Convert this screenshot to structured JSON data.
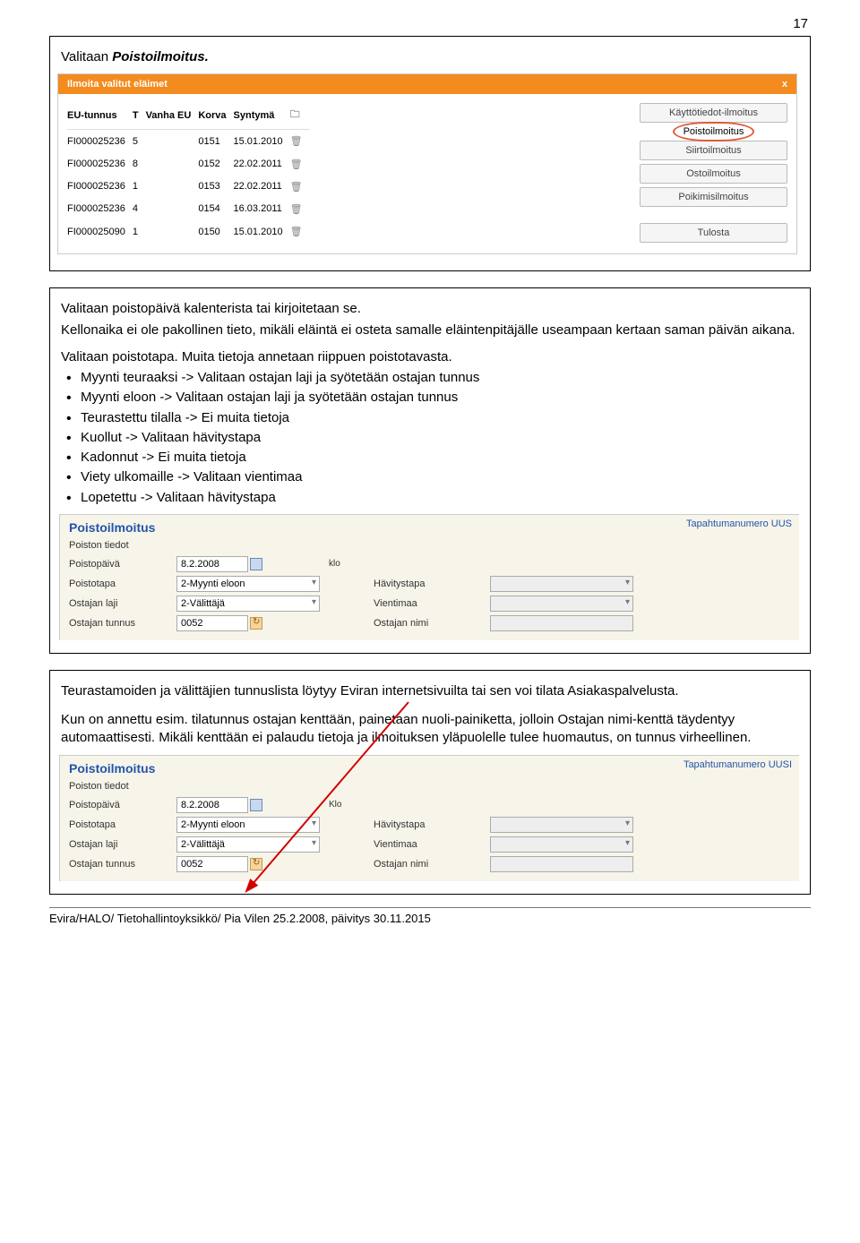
{
  "pageNumber": "17",
  "box1": {
    "intro1": "Valitaan ",
    "intro2": "Poistoilmoitus."
  },
  "shot1": {
    "header": "Ilmoita valitut eläimet",
    "cols": [
      "EU-tunnus",
      "T",
      "Vanha EU",
      "Korva",
      "Syntymä"
    ],
    "rows": [
      {
        "eu": "FI000025236",
        "t": "5",
        "v": "",
        "korva": "0151",
        "s": "15.01.2010"
      },
      {
        "eu": "FI000025236",
        "t": "8",
        "v": "",
        "korva": "0152",
        "s": "22.02.2011"
      },
      {
        "eu": "FI000025236",
        "t": "1",
        "v": "",
        "korva": "0153",
        "s": "22.02.2011"
      },
      {
        "eu": "FI000025236",
        "t": "4",
        "v": "",
        "korva": "0154",
        "s": "16.03.2011"
      },
      {
        "eu": "FI000025090",
        "t": "1",
        "v": "",
        "korva": "0150",
        "s": "15.01.2010"
      }
    ],
    "buttons": {
      "kt": "Käyttötiedot-ilmoitus",
      "poisto": "Poistoilmoitus",
      "siirto": "Siirtoilmoitus",
      "osto": "Ostoilmoitus",
      "poikimi": "Poikimisilmoitus",
      "tulosta": "Tulosta"
    },
    "close": "x"
  },
  "box2": {
    "l1": "Valitaan poistopäivä kalenterista tai kirjoitetaan se.",
    "l2": "Kellonaika ei ole pakollinen tieto, mikäli eläintä ei osteta samalle eläintenpitäjälle useampaan kertaan saman päivän aikana.",
    "l3": "Valitaan poistotapa. Muita tietoja annetaan riippuen poistotavasta.",
    "bullets": [
      "Myynti teuraaksi -> Valitaan ostajan laji ja syötetään ostajan tunnus",
      "Myynti eloon -> Valitaan ostajan laji ja syötetään ostajan tunnus",
      "Teurastettu tilalla -> Ei muita tietoja",
      "Kuollut -> Valitaan hävitystapa",
      "Kadonnut -> Ei muita tietoja",
      "Viety ulkomaille -> Valitaan vientimaa",
      "Lopetettu -> Valitaan hävitystapa"
    ]
  },
  "form": {
    "tapnum_short": "Tapahtumanumero UUS",
    "tapnum_long": "Tapahtumanumero UUSI",
    "title": "Poistoilmoitus",
    "section": "Poiston tiedot",
    "labels": {
      "pvm": "Poistopäivä",
      "ptapa": "Poistotapa",
      "laji": "Ostajan laji",
      "tunnus": "Ostajan tunnus",
      "havitys": "Hävitystapa",
      "vientimaa": "Vientimaa",
      "nimi": "Ostajan nimi",
      "klo": "klo",
      "KloCap": "Klo"
    },
    "values": {
      "pvm": "8.2.2008",
      "ptapa": "2-Myynti eloon",
      "laji": "2-Välittäjä",
      "tunnus": "0052"
    }
  },
  "box3": {
    "l1": "Teurastamoiden ja välittäjien tunnuslista löytyy Eviran internetsivuilta tai sen voi tilata Asiakaspalvelusta.",
    "l2a": "Kun on annettu esim. tilatunnus ostajan kenttään, painetaan nuoli-painiketta, jolloin Ostajan nimi-kenttä täydentyy automaattisesti. Mikäli kenttään ei palaudu tietoja ja ilmoituksen yläpuolelle tulee huomautus, on tunnus virheellinen."
  },
  "footer": "Evira/HALO/ Tietohallintoyksikkö/ Pia Vilen 25.2.2008, päivitys 30.11.2015"
}
